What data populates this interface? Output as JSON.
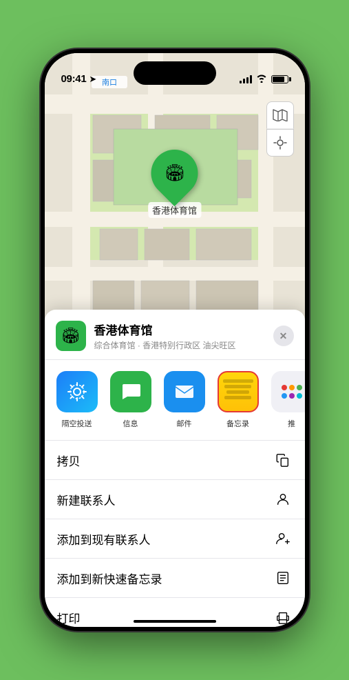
{
  "status_bar": {
    "time": "09:41",
    "location_arrow": "▶"
  },
  "map": {
    "label_icon": "南口",
    "venue_name": "香港体育馆",
    "pin_emoji": "🏟"
  },
  "map_controls": {
    "map_btn": "🗺",
    "location_btn": "⊕"
  },
  "sheet": {
    "venue_icon": "🏟",
    "venue_name": "香港体育馆",
    "venue_sub": "综合体育馆 · 香港特别行政区 油尖旺区",
    "close_label": "✕"
  },
  "share_items": [
    {
      "id": "airdrop",
      "label": "隔空投送",
      "icon": "📡"
    },
    {
      "id": "messages",
      "label": "信息",
      "icon": "💬"
    },
    {
      "id": "mail",
      "label": "邮件",
      "icon": "✉️"
    },
    {
      "id": "notes",
      "label": "备忘录",
      "icon": ""
    },
    {
      "id": "more",
      "label": "推",
      "icon": ""
    }
  ],
  "actions": [
    {
      "id": "copy",
      "label": "拷贝",
      "icon": "copy"
    },
    {
      "id": "new-contact",
      "label": "新建联系人",
      "icon": "person"
    },
    {
      "id": "add-existing",
      "label": "添加到现有联系人",
      "icon": "person-add"
    },
    {
      "id": "add-notes",
      "label": "添加到新快速备忘录",
      "icon": "note"
    },
    {
      "id": "print",
      "label": "打印",
      "icon": "printer"
    }
  ]
}
